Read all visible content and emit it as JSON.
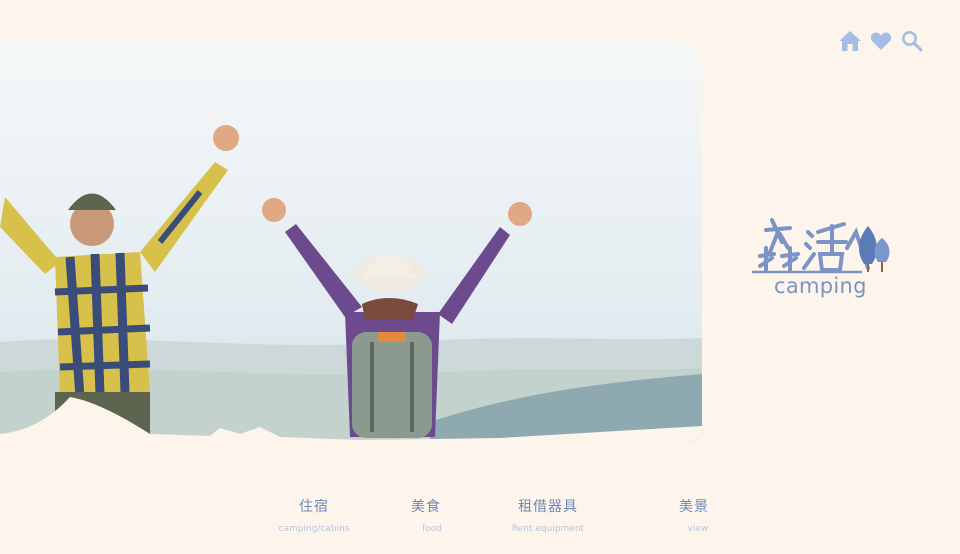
{
  "header": {
    "icons": [
      {
        "name": "home-icon"
      },
      {
        "name": "heart-icon"
      },
      {
        "name": "search-icon"
      }
    ]
  },
  "brand": {
    "logo_mark": "森活",
    "logo_sub": "camping",
    "accent_color": "#7b94c4"
  },
  "nav": {
    "items": [
      {
        "label": "住宿",
        "sub": "camping/cabins"
      },
      {
        "label": "美食",
        "sub": "food"
      },
      {
        "label": "租借器具",
        "sub": "Rent equipment"
      },
      {
        "label": "美景",
        "sub": "view"
      }
    ]
  },
  "colors": {
    "background": "#fdf5ec",
    "nav_text": "#6e88b6",
    "nav_sub": "#b7c4dc"
  }
}
